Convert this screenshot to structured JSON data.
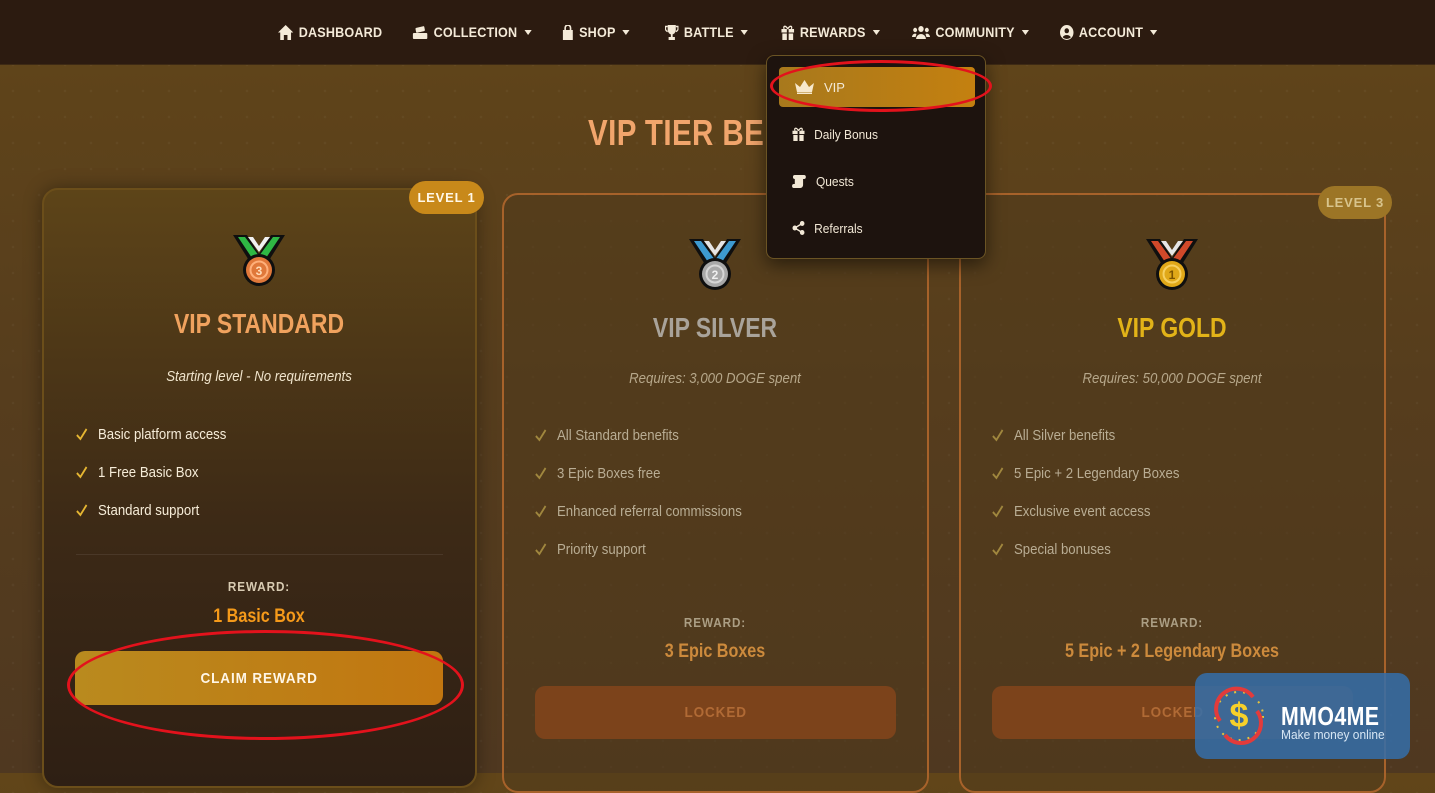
{
  "nav": {
    "items": [
      {
        "label": "DASHBOARD",
        "icon": "home-icon"
      },
      {
        "label": "COLLECTION",
        "icon": "boxes-icon"
      },
      {
        "label": "SHOP",
        "icon": "bag-icon"
      },
      {
        "label": "BATTLE",
        "icon": "trophy-icon"
      },
      {
        "label": "REWARDS",
        "icon": "gift-icon"
      },
      {
        "label": "COMMUNITY",
        "icon": "users-icon"
      },
      {
        "label": "ACCOUNT",
        "icon": "user-circle-icon"
      }
    ]
  },
  "rewards_menu": {
    "items": [
      {
        "label": "VIP",
        "icon": "crown-icon",
        "active": true
      },
      {
        "label": "Daily Bonus",
        "icon": "gift-icon"
      },
      {
        "label": "Quests",
        "icon": "scroll-icon"
      },
      {
        "label": "Referrals",
        "icon": "share-icon"
      }
    ]
  },
  "section": {
    "title": "VIP TIER BEN"
  },
  "tiers": [
    {
      "level": "LEVEL 1",
      "name": "VIP STANDARD",
      "requirement": "Starting level - No requirements",
      "benefits": [
        "Basic platform access",
        "1 Free Basic Box",
        "Standard support"
      ],
      "reward_label": "REWARD:",
      "reward_value": "1 Basic Box",
      "button": "CLAIM REWARD",
      "medal_number": "3",
      "colors": {
        "name": "#f0a25e",
        "ribbon": "#2fb744",
        "medal": "#e0783a"
      }
    },
    {
      "name": "VIP SILVER",
      "requirement": "Requires: 3,000 DOGE spent",
      "benefits": [
        "All Standard benefits",
        "3 Epic Boxes free",
        "Enhanced referral commissions",
        "Priority support"
      ],
      "reward_label": "REWARD:",
      "reward_value": "3 Epic Boxes",
      "button": "LOCKED",
      "medal_number": "2",
      "colors": {
        "name": "#a9a39a",
        "ribbon": "#3d9ad0",
        "medal": "#a8a8a8"
      }
    },
    {
      "level": "LEVEL 3",
      "name": "VIP GOLD",
      "requirement": "Requires: 50,000 DOGE spent",
      "benefits": [
        "All Silver benefits",
        "5 Epic + 2 Legendary Boxes",
        "Exclusive event access",
        "Special bonuses"
      ],
      "reward_label": "REWARD:",
      "reward_value": "5 Epic + 2 Legendary Boxes",
      "button": "LOCKED",
      "medal_number": "1",
      "colors": {
        "name": "#e2b318",
        "ribbon": "#d0492a",
        "medal": "#e0a818"
      }
    }
  ],
  "watermark": {
    "name": "MMO4ME",
    "tagline": "Make money online"
  }
}
